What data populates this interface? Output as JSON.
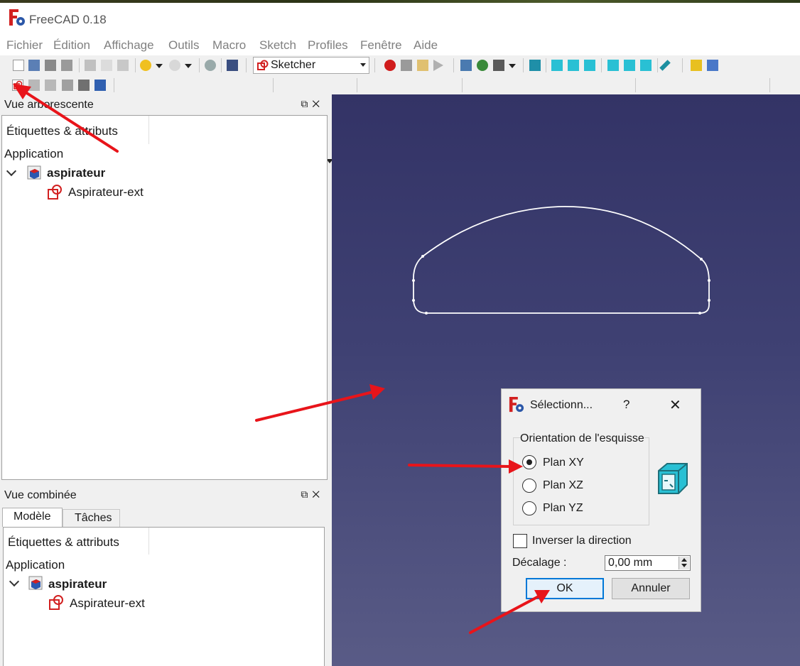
{
  "app": {
    "title": "FreeCAD 0.18",
    "brand_color": "#d22020"
  },
  "menubar": {
    "items": [
      "Fichier",
      "Édition",
      "Affichage",
      "Outils",
      "Macro",
      "Sketch",
      "Profiles",
      "Fenêtre",
      "Aide"
    ]
  },
  "toolbar": {
    "workbench": "Sketcher"
  },
  "tree_panel": {
    "title": "Vue arborescente",
    "column_header": "Étiquettes & attributs",
    "root": "Application",
    "document": "aspirateur",
    "sketch": "Aspirateur-ext"
  },
  "combo_panel": {
    "title": "Vue combinée",
    "tabs": [
      "Modèle",
      "Tâches"
    ],
    "active_tab": "Modèle",
    "column_header": "Étiquettes & attributs",
    "root": "Application",
    "document": "aspirateur",
    "sketch": "Aspirateur-ext"
  },
  "viewport": {
    "background_top": "#333366",
    "background_bottom": "#595b86",
    "sketch_color": "#ffffff"
  },
  "dialog": {
    "title": "Sélectionn...",
    "help": "?",
    "close": "✕",
    "group_title": "Orientation de l'esquisse",
    "options": [
      "Plan XY",
      "Plan XZ",
      "Plan YZ"
    ],
    "selected_option": "Plan XY",
    "invert_label": "Inverser la direction",
    "invert_checked": false,
    "offset_label": "Décalage :",
    "offset_value": "0,00 mm",
    "ok_label": "OK",
    "cancel_label": "Annuler"
  },
  "annotations": {
    "arrow_color": "#e8141a"
  }
}
